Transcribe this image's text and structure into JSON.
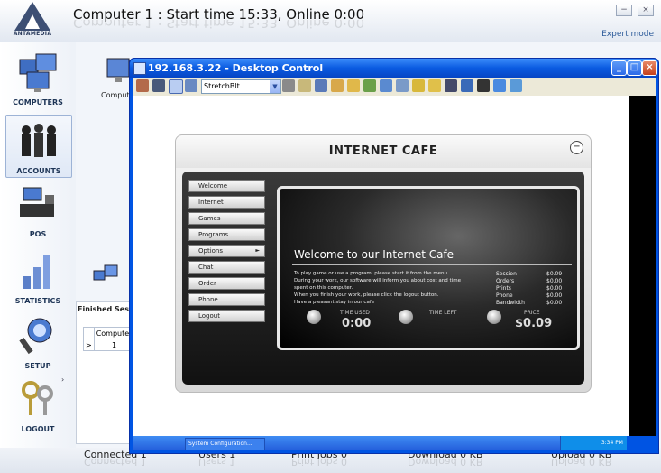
{
  "app": {
    "logo_text": "ANTAMEDIA",
    "title": "Computer 1 : Start time 15:33, Online 0:00",
    "expert_mode": "Expert mode",
    "minimize": "−",
    "close": "×"
  },
  "sidebar": {
    "items": [
      {
        "label": "COMPUTERS"
      },
      {
        "label": "ACCOUNTS"
      },
      {
        "label": "POS"
      },
      {
        "label": "STATISTICS"
      },
      {
        "label": "SETUP"
      },
      {
        "label": "LOGOUT"
      }
    ],
    "arrow": "›"
  },
  "background": {
    "computer_label": "Compute",
    "finished_title": "Finished Sess",
    "table_header": "Computer",
    "table_row_marker": ">",
    "table_row_value": "1"
  },
  "status": {
    "connected": "Connected 1",
    "users": "Users 1",
    "print_jobs": "Print Jobs 0",
    "download": "Download 0 KB",
    "upload": "Upload 0 KB"
  },
  "remote_window": {
    "title": "192.168.3.22 - Desktop Control",
    "scale_mode": "StretchBlt",
    "taskbar_item": "System Configuration...",
    "tray_time": "3:34 PM"
  },
  "cafe": {
    "title": "INTERNET CAFE",
    "minimize": "−",
    "menu": [
      {
        "label": "Welcome"
      },
      {
        "label": "Internet"
      },
      {
        "label": "Games"
      },
      {
        "label": "Programs"
      },
      {
        "label": "Options",
        "arrow": "►"
      },
      {
        "label": "Chat"
      },
      {
        "label": "Order"
      },
      {
        "label": "Phone"
      },
      {
        "label": "Logout"
      }
    ],
    "welcome": "Welcome to our Internet Cafe",
    "text_lines": [
      "To play game or use a program, please start it from the menu.",
      "During your work, our software will inform you about cost and time",
      "spent on this computer.",
      "When you finish your work, please click the logout button.",
      "Have a pleasant stay in our cafe"
    ],
    "summary": [
      {
        "label": "Session",
        "value": "$0.09"
      },
      {
        "label": "Orders",
        "value": "$0.00"
      },
      {
        "label": "Prints",
        "value": "$0.00"
      },
      {
        "label": "Phone",
        "value": "$0.00"
      },
      {
        "label": "Bandwidth",
        "value": "$0.00"
      }
    ],
    "time_used_label": "TIME USED",
    "time_used": "0:00",
    "time_left_label": "TIME LEFT",
    "price_label": "PRICE",
    "price": "$0.09"
  }
}
